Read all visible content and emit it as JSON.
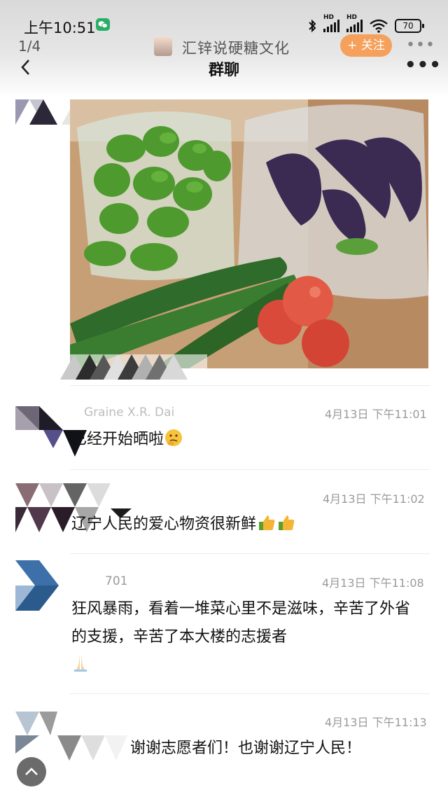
{
  "status_bar": {
    "time": "上午10:51",
    "network_label": "HD",
    "battery": "70"
  },
  "viewer": {
    "page_indicator": "1/4",
    "channel_name": "汇锌说硬糖文化",
    "follow_label": "+ 关注",
    "more_icon": "more-dots-icon"
  },
  "header": {
    "title": "群聊",
    "back_icon": "chevron-left-icon",
    "more_icon": "more-dots-icon"
  },
  "photo": {
    "description_icon": "vegetables-photo"
  },
  "messages": [
    {
      "name": "Graine X.R. Dai",
      "time": "4月13日 下午11:01",
      "text": "已经开始晒啦",
      "emoji": "thinking-face"
    },
    {
      "name": "",
      "time": "4月13日 下午11:02",
      "text": "辽宁人民的爱心物资很新鲜",
      "emoji": "thumbs-up x2"
    },
    {
      "name": "701",
      "time": "4月13日 下午11:08",
      "text": "狂风暴雨，看着一堆菜心里不是滋味，辛苦了外省的支援，辛苦了本大楼的志援者",
      "emoji": "praying-hands"
    },
    {
      "name": "",
      "time": "4月13日 下午11:13",
      "text": "谢谢志愿者们！也谢谢辽宁人民！",
      "emoji": ""
    }
  ],
  "colors": {
    "follow_button": "#f5a05b",
    "wechat_green": "#2aae67"
  }
}
